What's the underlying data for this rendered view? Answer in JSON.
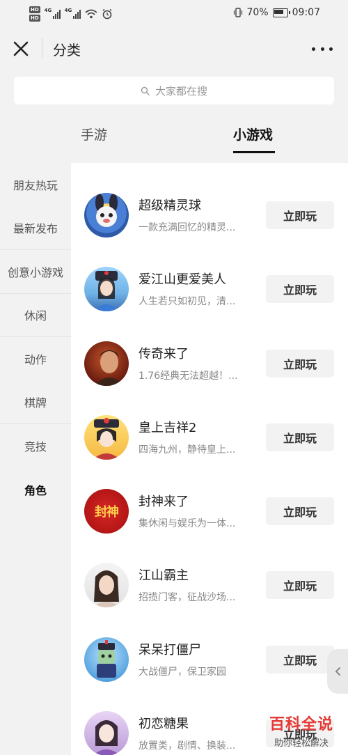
{
  "status_bar": {
    "hd_top": "HD",
    "hd_bottom": "HD",
    "net1": "4G",
    "net2": "4G",
    "battery": "70%",
    "time": "09:07"
  },
  "nav": {
    "title": "分类"
  },
  "search": {
    "placeholder": "大家都在搜"
  },
  "tabs": [
    {
      "label": "手游",
      "active": false
    },
    {
      "label": "小游戏",
      "active": true
    }
  ],
  "sidebar": {
    "items": [
      {
        "label": "朋友热玩"
      },
      {
        "label": "最新发布"
      },
      {
        "label": "创意小游戏"
      },
      {
        "label": "休闲"
      },
      {
        "label": "动作"
      },
      {
        "label": "棋牌"
      },
      {
        "label": "竞技"
      },
      {
        "label": "角色",
        "active": true
      }
    ]
  },
  "games": [
    {
      "name": "超级精灵球",
      "desc": "一款充满回忆的精灵...",
      "button": "立即玩"
    },
    {
      "name": "爱江山更爱美人",
      "desc": "人生若只如初见，清...",
      "button": "立即玩"
    },
    {
      "name": "传奇来了",
      "desc": "1.76经典无法超越！...",
      "button": "立即玩"
    },
    {
      "name": "皇上吉祥2",
      "desc": "四海九州，静待皇上...",
      "button": "立即玩"
    },
    {
      "name": "封神来了",
      "desc": "集休闲与娱乐为一体...",
      "button": "立即玩",
      "icon_text": "封神"
    },
    {
      "name": "江山霸主",
      "desc": "招揽门客，征战沙场...",
      "button": "立即玩"
    },
    {
      "name": "呆呆打僵尸",
      "desc": "大战僵尸，保卫家园",
      "button": "立即玩"
    },
    {
      "name": "初恋糖果",
      "desc": "放置类，剧情、换装...",
      "button": "立即玩"
    }
  ],
  "watermark": {
    "title": "百科全说",
    "subtitle": "助你轻松解决"
  },
  "colors": {
    "background": "#f2f2f2",
    "list_background": "#ffffff",
    "watermark_red": "#e53935"
  },
  "icons": {
    "close": "close-icon",
    "more": "more-icon",
    "search": "search-icon",
    "handle": "chevron-left-icon"
  }
}
